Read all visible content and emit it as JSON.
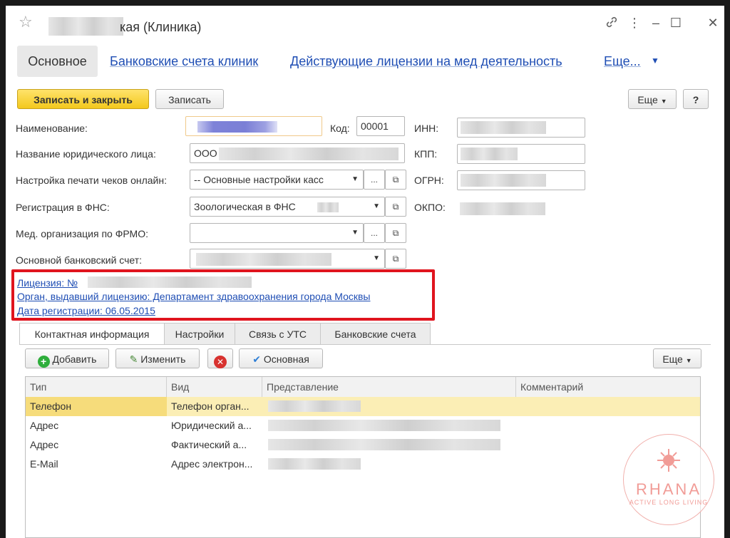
{
  "window": {
    "title": "кая (Клиника)",
    "icons": [
      "star-icon",
      "link-icon",
      "more-icon",
      "minimize-icon",
      "maximize-icon",
      "close-icon"
    ]
  },
  "nav": {
    "active": "Основное",
    "links": [
      "Банковские счета клиник",
      "Действующие лицензии на мед деятельность",
      "Еще..."
    ]
  },
  "toolbar": {
    "save_close": "Записать и закрыть",
    "save": "Записать",
    "more": "Еще",
    "help": "?"
  },
  "form": {
    "name_label": "Наименование:",
    "code_label": "Код:",
    "code_value": "00001",
    "inn_label": "ИНН:",
    "legal_label": "Название юридического лица:",
    "legal_value": "ООО",
    "kpp_label": "КПП:",
    "print_label": "Настройка печати чеков онлайн:",
    "print_value": "-- Основные настройки касс",
    "ogrn_label": "ОГРН:",
    "fns_label": "Регистрация в ФНС:",
    "fns_value": "Зоологическая в ФНС",
    "okpo_label": "ОКПО:",
    "frmo_label": "Мед. организация по ФРМО:",
    "bank_label": "Основной банковский счет:"
  },
  "license": {
    "number": "Лицензия: №",
    "authority": "Орган, выдавший лицензию:  Департамент здравоохранения города Москвы",
    "date": "Дата регистрации: 06.05.2015"
  },
  "tabs": [
    "Контактная информация",
    "Настройки",
    "Связь с УТС",
    "Банковские счета"
  ],
  "contact_toolbar": {
    "add": "Добавить",
    "edit": "Изменить",
    "main": "Основная",
    "more": "Еще"
  },
  "table": {
    "columns": [
      "Тип",
      "Вид",
      "Представление",
      "Комментарий"
    ],
    "rows": [
      {
        "type": "Телефон",
        "kind": "Телефон орган..."
      },
      {
        "type": "Адрес",
        "kind": "Юридический а..."
      },
      {
        "type": "Адрес",
        "kind": "Фактический а..."
      },
      {
        "type": "E-Mail",
        "kind": "Адрес электрон..."
      }
    ]
  },
  "watermark": {
    "brand": "RHANA",
    "tagline": "ACTIVE LONG LIVING"
  },
  "colors": {
    "accent_link": "#1f4eb4",
    "primary_button": "#f3c81c",
    "highlight_row": "#fbeeb5",
    "annotation": "#e0141e"
  }
}
